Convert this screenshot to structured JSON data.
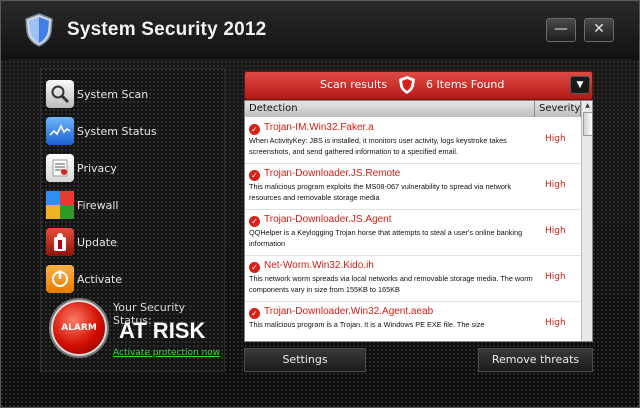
{
  "window": {
    "title": "System Security  2012",
    "minimize_glyph": "—",
    "close_glyph": "✕"
  },
  "sidebar": {
    "items": [
      {
        "label": "System Scan",
        "icon": "magnifier-icon",
        "glyph": "🔍"
      },
      {
        "label": "System Status",
        "icon": "chart-wave-icon",
        "glyph": "∿"
      },
      {
        "label": "Privacy",
        "icon": "document-icon",
        "glyph": "≡"
      },
      {
        "label": "Firewall",
        "icon": "firewall-blocks-icon",
        "glyph": ""
      },
      {
        "label": "Update",
        "icon": "update-icon",
        "glyph": "▲"
      },
      {
        "label": "Activate",
        "icon": "activate-icon",
        "glyph": "☉"
      }
    ]
  },
  "status": {
    "alarm_label": "ALARM",
    "caption": "Your Security Status:",
    "value": "AT RISK",
    "activate_link": "Activate protection now"
  },
  "scan": {
    "title": "Scan results",
    "count": "6 Items Found",
    "dropdown_glyph": "▼",
    "columns": [
      "Detection",
      "Severity"
    ],
    "rows": [
      {
        "name": "Trojan-IM.Win32.Faker.a",
        "desc": "When ActivityKey: JBS is installed, it monitors user activity, logs keystroke takes screenshots, and send gathered information to a specified email.",
        "severity": "High"
      },
      {
        "name": "Trojan-Downloader.JS.Remote",
        "desc": "This malicious program exploits the MS08-067 vulnerability to spread via network resources and removable storage media",
        "severity": "High"
      },
      {
        "name": "Trojan-Downloader.JS.Agent",
        "desc": "QQHelper is a Keylogging Trojan horse that attempts to steal a user's online banking information",
        "severity": "High"
      },
      {
        "name": "Net-Worm.Win32.Kido.ih",
        "desc": "This network worm spreads via local networks and removable storage media. The worm components vary in size from 155KB to 165KB",
        "severity": "High"
      },
      {
        "name": "Trojan-Downloader.Win32.Agent.aeab",
        "desc": "This malicious program is a Trojan. It is a Windows PE EXE file. The size",
        "severity": "High"
      }
    ]
  },
  "footer": {
    "settings_label": "Settings",
    "remove_label": "Remove threats"
  },
  "colors": {
    "accent_red": "#c8201b",
    "threat_text": "#d51d14",
    "link_green": "#39d33b"
  }
}
